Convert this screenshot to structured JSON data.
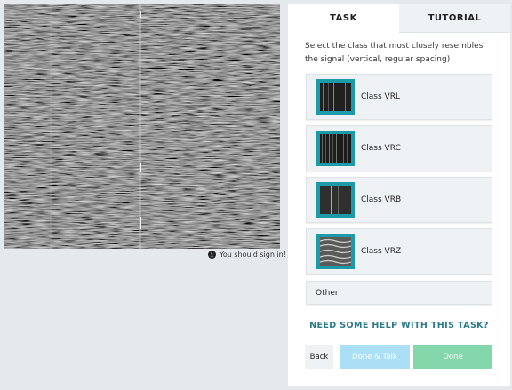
{
  "task_panel": {
    "tabs": [
      {
        "label": "TASK",
        "active": true
      },
      {
        "label": "TUTORIAL",
        "active": false
      }
    ],
    "question": "Select the class that most closely resembles the signal (vertical, regular spacing)",
    "options": [
      {
        "label": "Class VRL",
        "thumbnail": "vrl-thumbnail"
      },
      {
        "label": "Class VRC",
        "thumbnail": "vrc-thumbnail"
      },
      {
        "label": "Class VRB",
        "thumbnail": "vrb-thumbnail"
      },
      {
        "label": "Class VRZ",
        "thumbnail": "vrz-thumbnail"
      }
    ],
    "other_label": "Other",
    "help_link": "NEED SOME HELP WITH THIS TASK?",
    "buttons": {
      "back": "Back",
      "done_talk": "Done & Talk",
      "done": "Done"
    }
  },
  "notice": {
    "signin": "You should sign in!",
    "icon": "info-icon"
  },
  "colors": {
    "accent_teal": "#1b9aaa",
    "done_green": "#84d6ab",
    "talk_blue": "#aadff6",
    "help_link": "#2b7a8a"
  }
}
